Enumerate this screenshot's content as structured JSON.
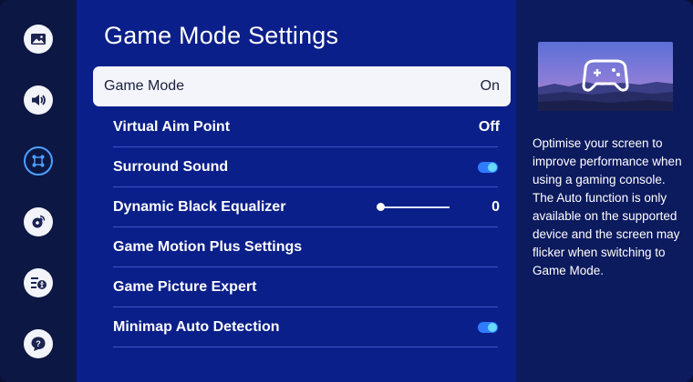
{
  "sidebar": {
    "items": [
      {
        "icon": "picture-icon"
      },
      {
        "icon": "sound-icon"
      },
      {
        "icon": "game-mode-icon",
        "active": true
      },
      {
        "icon": "broadcast-icon"
      },
      {
        "icon": "accessibility-icon"
      },
      {
        "icon": "support-icon"
      }
    ]
  },
  "main": {
    "title": "Game Mode Settings",
    "items": [
      {
        "label": "Game Mode",
        "value": "On",
        "selected": true
      },
      {
        "label": "Virtual Aim Point",
        "value": "Off"
      },
      {
        "label": "Surround Sound",
        "toggle": true
      },
      {
        "label": "Dynamic Black Equalizer",
        "value": "0",
        "slider_fraction": 0
      },
      {
        "label": "Game Motion Plus Settings"
      },
      {
        "label": "Game Picture Expert"
      },
      {
        "label": "Minimap Auto Detection",
        "toggle": true
      }
    ]
  },
  "info": {
    "preview_icon": "gamepad-icon",
    "description": "Optimise your screen to improve performance when using a gaming console. The Auto function is only available on the supported device and the screen may flicker when switching to Game Mode."
  },
  "colors": {
    "main_bg": "#0b1f8a",
    "sidebar_bg": "#0d1744",
    "info_bg": "#0c1a5e",
    "selected_bg": "#f4f5fb",
    "toggle": "#2f7bff",
    "accent": "#4da1ff"
  }
}
